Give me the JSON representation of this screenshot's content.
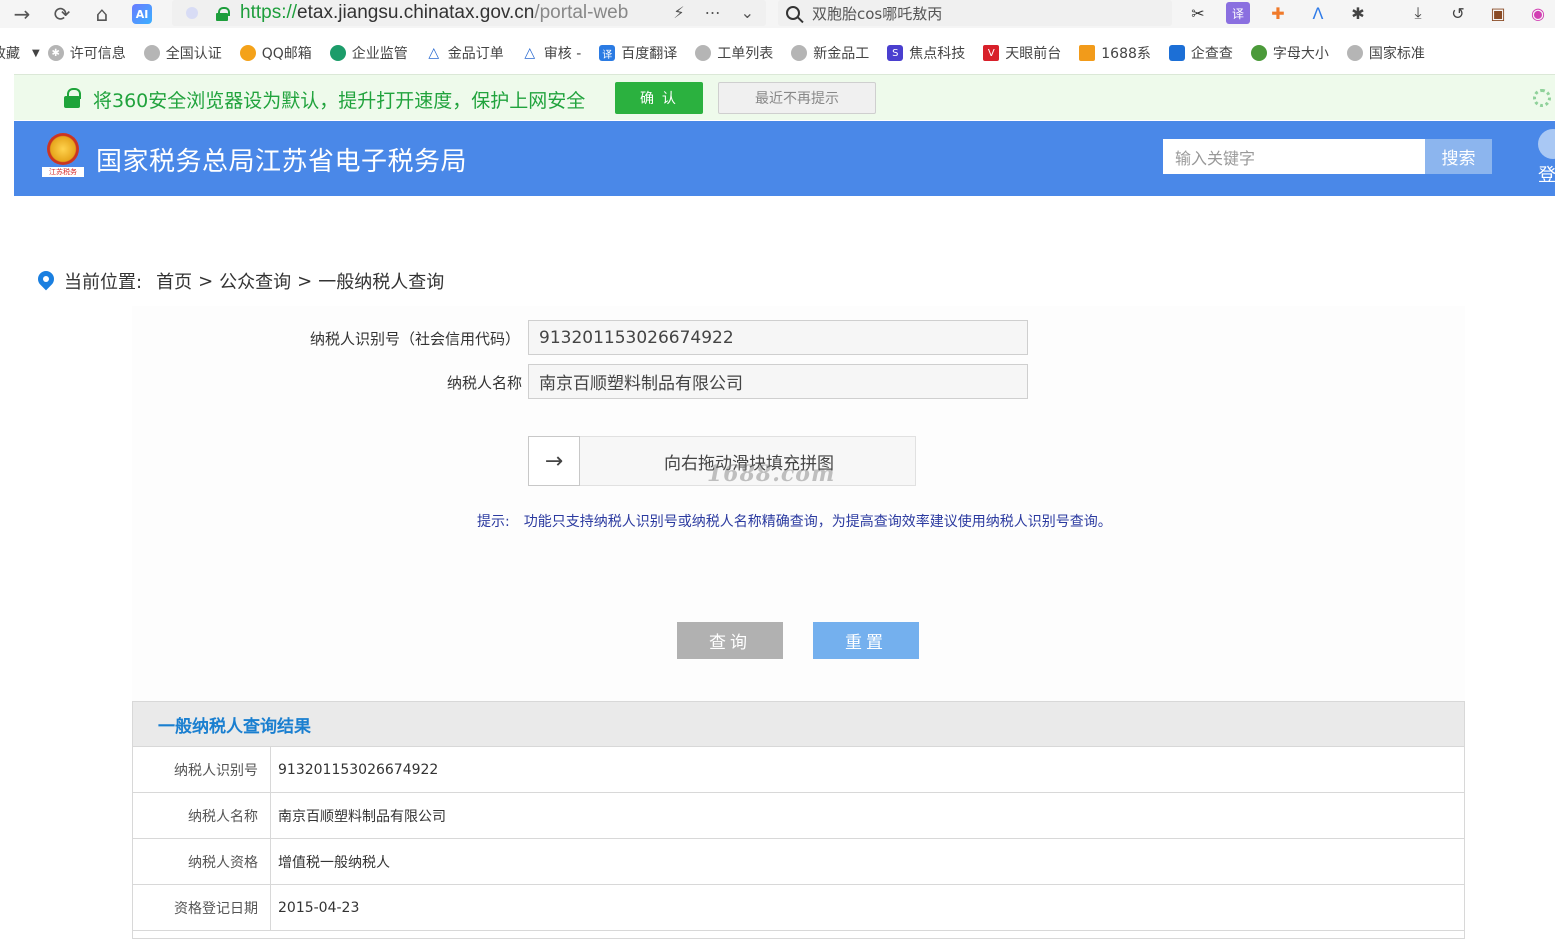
{
  "browser": {
    "url_scheme": "https://",
    "url_host": "etax.jiangsu.chinatax.gov.cn",
    "url_path": "/portal-web",
    "ai_badge": "AI",
    "search_text": "双胞胎cos哪吒敖丙",
    "translate_icon_text": "译"
  },
  "bookmarks": {
    "items": [
      {
        "label": "收藏",
        "color": "#888888"
      },
      {
        "label": "许可信息",
        "color": "#9a9a9a"
      },
      {
        "label": "全国认证",
        "color": "#9a9a9a"
      },
      {
        "label": "QQ邮箱",
        "color": "#f4a21a"
      },
      {
        "label": "企业监管",
        "color": "#1c9c6a"
      },
      {
        "label": "金品订单",
        "color": "#2b6bd1"
      },
      {
        "label": "审核 -",
        "color": "#2b6bd1"
      },
      {
        "label": "百度翻译",
        "color": "#2b7be3"
      },
      {
        "label": "工单列表",
        "color": "#9a9a9a"
      },
      {
        "label": "新金品工",
        "color": "#9a9a9a"
      },
      {
        "label": "焦点科技",
        "color": "#4a3fcf"
      },
      {
        "label": "天眼前台",
        "color": "#d8202a"
      },
      {
        "label": "1688系",
        "color": "#f29b1a"
      },
      {
        "label": "企查查",
        "color": "#1c6fd6"
      },
      {
        "label": "字母大小",
        "color": "#4b9a3a"
      },
      {
        "label": "国家标准",
        "color": "#9a9a9a"
      }
    ]
  },
  "banner": {
    "text": "将360安全浏览器设为默认，提升打开速度，保护上网安全",
    "confirm": "确 认",
    "dismiss": "最近不再提示"
  },
  "header": {
    "emblem_caption": "江苏税务",
    "title": "国家税务总局江苏省电子税务局",
    "search_placeholder": "输入关键字",
    "search_button": "搜索",
    "login": "登"
  },
  "breadcrumb": {
    "label": "当前位置:",
    "items": [
      "首页",
      "公众查询",
      "一般纳税人查询"
    ],
    "separator": ">"
  },
  "form": {
    "id_label": "纳税人识别号（社会信用代码）",
    "id_value": "913201153026674922",
    "name_label": "纳税人名称",
    "name_value": "南京百顺塑料制品有限公司",
    "slider_arrow": "→",
    "slider_text": "向右拖动滑块填充拼图",
    "watermark": "1688.com",
    "tip_label": "提示:",
    "tip_text": "功能只支持纳税人识别号或纳税人名称精确查询，为提高查询效率建议使用纳税人识别号查询。",
    "query_button": "查询",
    "reset_button": "重置"
  },
  "result": {
    "title": "一般纳税人查询结果",
    "rows": [
      {
        "key": "纳税人识别号",
        "value": "913201153026674922"
      },
      {
        "key": "纳税人名称",
        "value": "南京百顺塑料制品有限公司"
      },
      {
        "key": "纳税人资格",
        "value": "增值税一般纳税人"
      },
      {
        "key": "资格登记日期",
        "value": "2015-04-23"
      }
    ]
  }
}
